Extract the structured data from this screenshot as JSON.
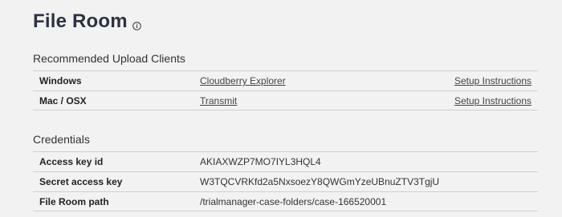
{
  "page": {
    "title": "File Room"
  },
  "upload_clients": {
    "heading": "Recommended Upload Clients",
    "rows": [
      {
        "platform": "Windows",
        "client": "Cloudberry Explorer",
        "setup": "Setup Instructions"
      },
      {
        "platform": "Mac / OSX",
        "client": "Transmit",
        "setup": "Setup Instructions"
      }
    ]
  },
  "credentials": {
    "heading": "Credentials",
    "rows": [
      {
        "label": "Access key id",
        "value": "AKIAXWZP7MO7IYL3HQL4"
      },
      {
        "label": "Secret access key",
        "value": "W3TQCVRKfd2a5NxsoezY8QWGmYzeUBnuZTV3TgjU"
      },
      {
        "label": "File Room path",
        "value": "/trialmanager-case-folders/case-166520001"
      }
    ]
  },
  "icons": {
    "title_info": "info-icon"
  }
}
